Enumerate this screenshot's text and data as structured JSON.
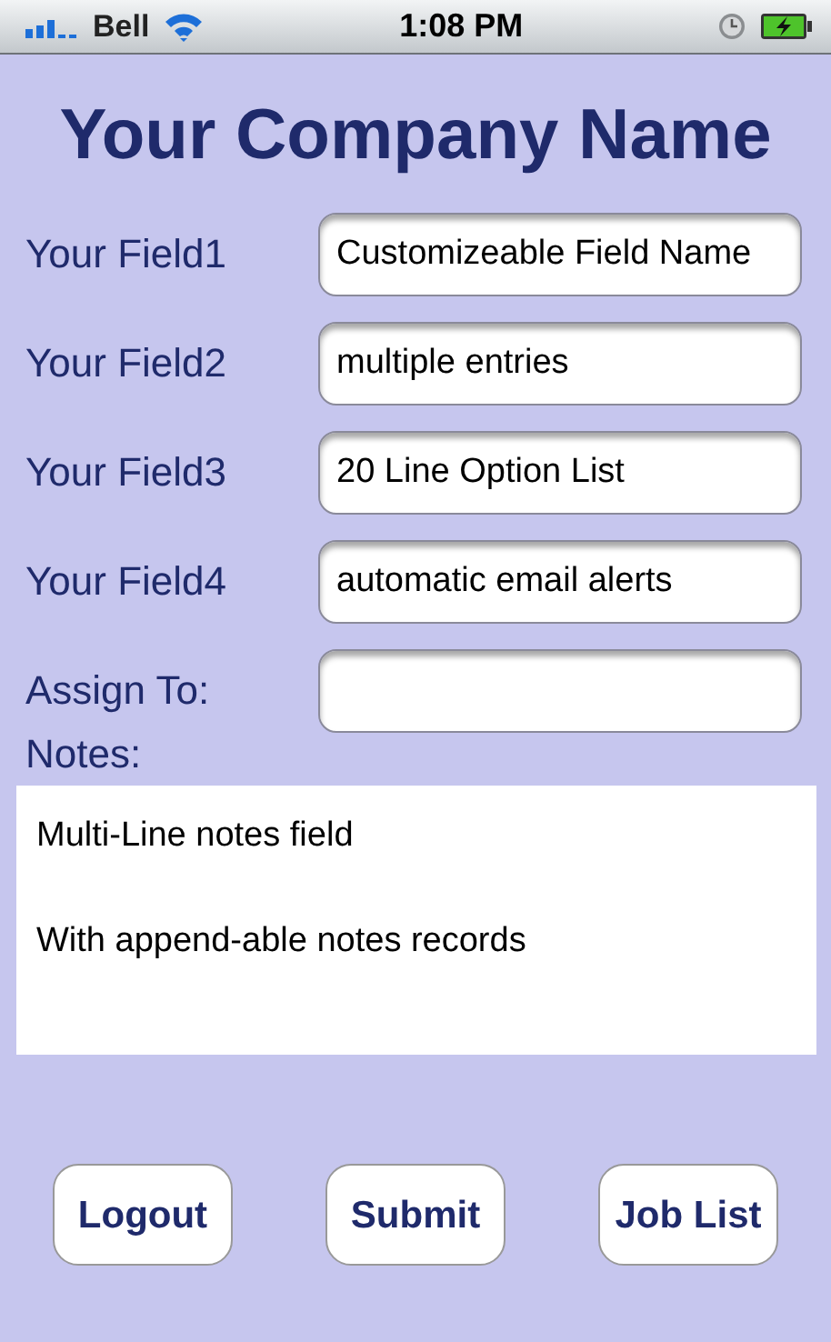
{
  "status_bar": {
    "carrier": "Bell",
    "time": "1:08 PM"
  },
  "title": "Your Company Name",
  "fields": [
    {
      "label": "Your Field1",
      "value": "Customizeable Field Name"
    },
    {
      "label": "Your Field2",
      "value": "multiple entries"
    },
    {
      "label": "Your Field3",
      "value": "20 Line Option List"
    },
    {
      "label": "Your Field4",
      "value": "automatic email alerts"
    },
    {
      "label": "Assign To:"
    }
  ],
  "notes": {
    "label": "Notes:",
    "lines": [
      "Multi-Line notes field",
      "With append-able notes records"
    ]
  },
  "buttons": [
    "Logout",
    "Submit",
    "Job List"
  ]
}
